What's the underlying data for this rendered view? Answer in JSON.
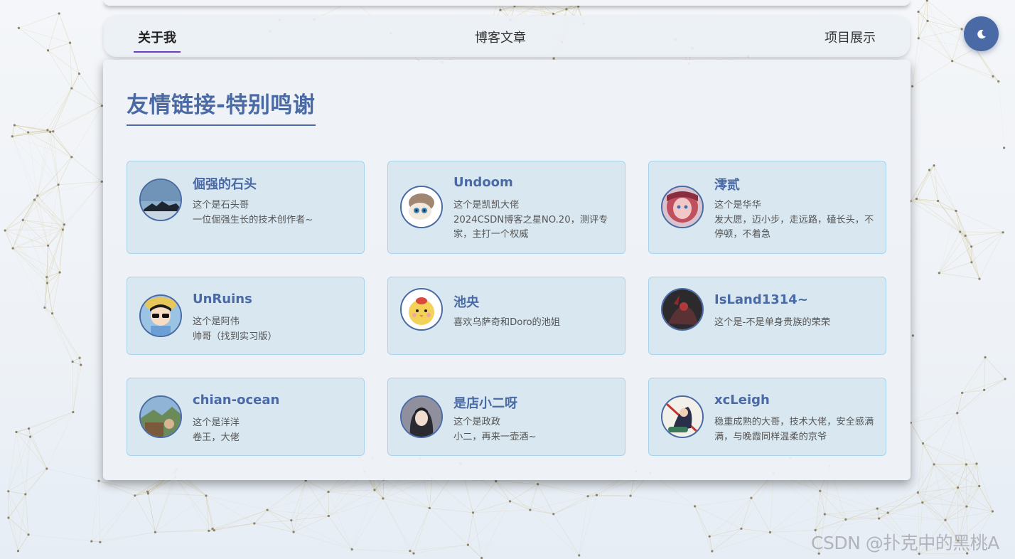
{
  "nav": {
    "about": "关于我",
    "blog": "博客文章",
    "projects": "项目展示"
  },
  "theme_toggle_icon": "moon-icon",
  "section": {
    "title": "友情链接-特别鸣谢"
  },
  "friends": [
    {
      "name": "倔强的石头",
      "lines": [
        "这个是石头哥",
        "一位倔强生长的技术创作者~"
      ],
      "avatar_icon": "landscape-avatar"
    },
    {
      "name": "Undoom",
      "lines": [
        "这个是凯凯大佬",
        "2024CSDN博客之星NO.20，测评专家，主打一个权威"
      ],
      "avatar_icon": "cartoon-cat-avatar"
    },
    {
      "name": "澪贰",
      "lines": [
        "这个是华华",
        "发大愿，迈小步，走远路，磕长头，不停顿，不着急"
      ],
      "avatar_icon": "anime-girl-avatar"
    },
    {
      "name": "UnRuins",
      "lines": [
        "这个是阿伟",
        "帅哥（找到实习版）"
      ],
      "avatar_icon": "sunglasses-boy-avatar"
    },
    {
      "name": "池央",
      "lines": [
        "喜欢乌萨奇和Doro的池姐"
      ],
      "avatar_icon": "chick-avatar"
    },
    {
      "name": "IsLand1314~",
      "lines": [
        "这个是-不是单身贵族的荣荣"
      ],
      "avatar_icon": "dark-character-avatar"
    },
    {
      "name": "chian-ocean",
      "lines": [
        "这个是洋洋",
        "卷王，大佬"
      ],
      "avatar_icon": "photo-avatar"
    },
    {
      "name": "是店小二呀",
      "lines": [
        "这个是政政",
        "小二，再来一壶酒~"
      ],
      "avatar_icon": "girl-avatar"
    },
    {
      "name": "xcLeigh",
      "lines": [
        "稳重成熟的大哥，技术大佬，安全感满满，与晚霞同样温柔的京爷"
      ],
      "avatar_icon": "warrior-avatar"
    }
  ],
  "watermark": "CSDN @扑克中的黑桃A",
  "colors": {
    "accent": "#4a6aa5",
    "card_bg": "#d7e6ef",
    "card_border": "#a9d3ec",
    "nav_underline": "#6a3fc4"
  }
}
